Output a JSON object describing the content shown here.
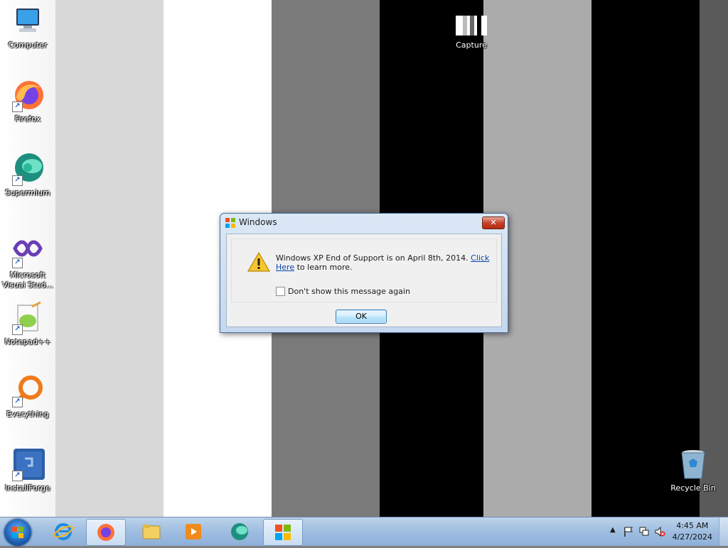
{
  "desktop": {
    "icons": [
      {
        "label": "Computer"
      },
      {
        "label": "Firefox"
      },
      {
        "label": "Supermium"
      },
      {
        "label": "Microsoft Visual Stud..."
      },
      {
        "label": "Notepad++"
      },
      {
        "label": "Everything"
      },
      {
        "label": "InstallForge"
      },
      {
        "label": "Capture"
      },
      {
        "label": "Recycle Bin"
      }
    ]
  },
  "dialog": {
    "title": "Windows",
    "close_label": "✕",
    "message": "Windows XP End of Support is on April 8th, 2014.",
    "link_text": "Click Here",
    "message_suffix": "to learn more.",
    "checkbox_label": "Don't show this message again",
    "checkbox_checked": false,
    "ok_label": "OK"
  },
  "taskbar": {
    "pinned": [
      "start",
      "internet-explorer",
      "firefox",
      "file-explorer",
      "media-player",
      "supermium",
      "windows-dialog"
    ],
    "clock_time": "4:45 AM",
    "clock_date": "4/27/2024",
    "tray_arrow": "▲"
  },
  "colors": {
    "taskbar": "#9fbde0",
    "dialog_close": "#c7432b",
    "link": "#0645ad"
  }
}
